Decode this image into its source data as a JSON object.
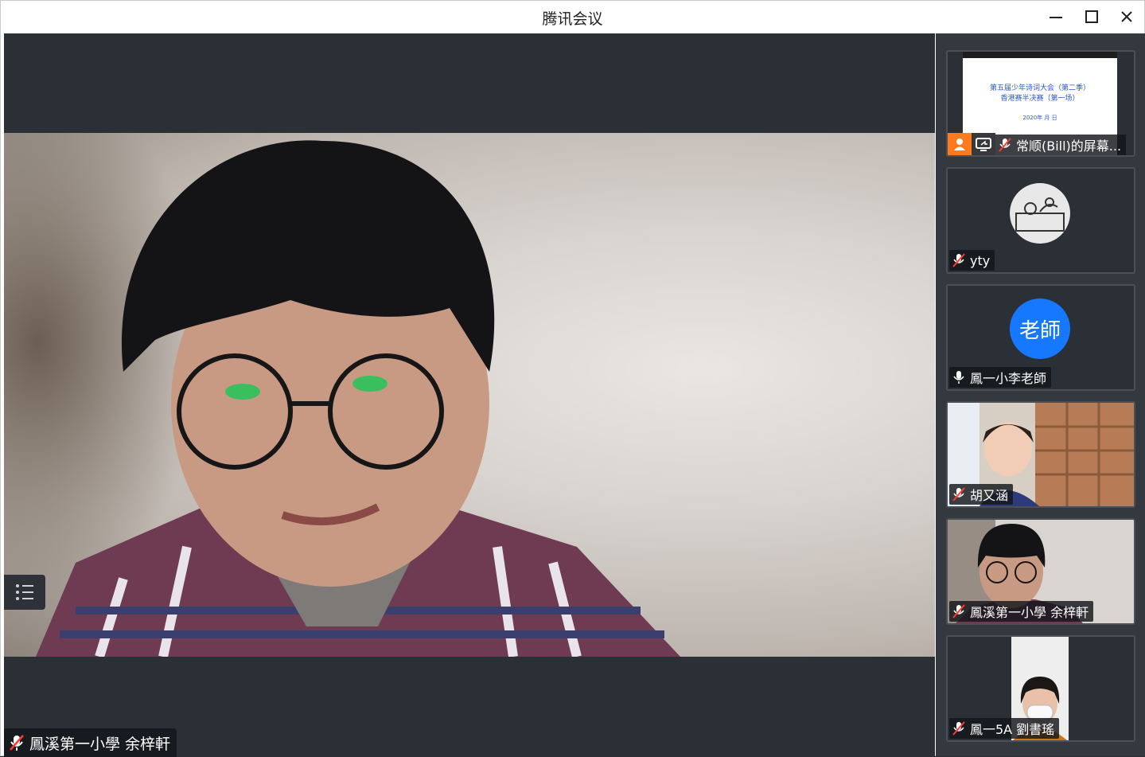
{
  "window": {
    "title": "腾讯会议"
  },
  "main": {
    "speaker_name": "鳳溪第一小學 余梓軒"
  },
  "participants": [
    {
      "name": "常顺(Bill)的屏幕...",
      "type": "screen-share",
      "mic": "muted",
      "slide": {
        "line1": "第五届少年诗词大会（第二季）",
        "line2": "香港赛半决赛（第一场）",
        "date": "2020年 月 日"
      }
    },
    {
      "name": "yty",
      "type": "avatar-image",
      "mic": "muted"
    },
    {
      "name": "鳳一小李老師",
      "type": "avatar-text",
      "avatar_text": "老師",
      "mic": "on",
      "avatar_color": "#1677ff"
    },
    {
      "name": "胡又涵",
      "type": "video",
      "mic": "muted"
    },
    {
      "name": "鳳溪第一小學 余梓軒",
      "type": "video",
      "mic": "muted"
    },
    {
      "name": "鳳一5A 劉書瑤",
      "type": "video",
      "mic": "muted"
    }
  ],
  "icons": {
    "minimize": "minimize-icon",
    "maximize": "maximize-icon",
    "close": "close-icon",
    "list": "list-icon",
    "mic_muted": "mic-muted-icon",
    "mic": "mic-icon",
    "user": "user-icon",
    "share": "screen-share-icon"
  }
}
